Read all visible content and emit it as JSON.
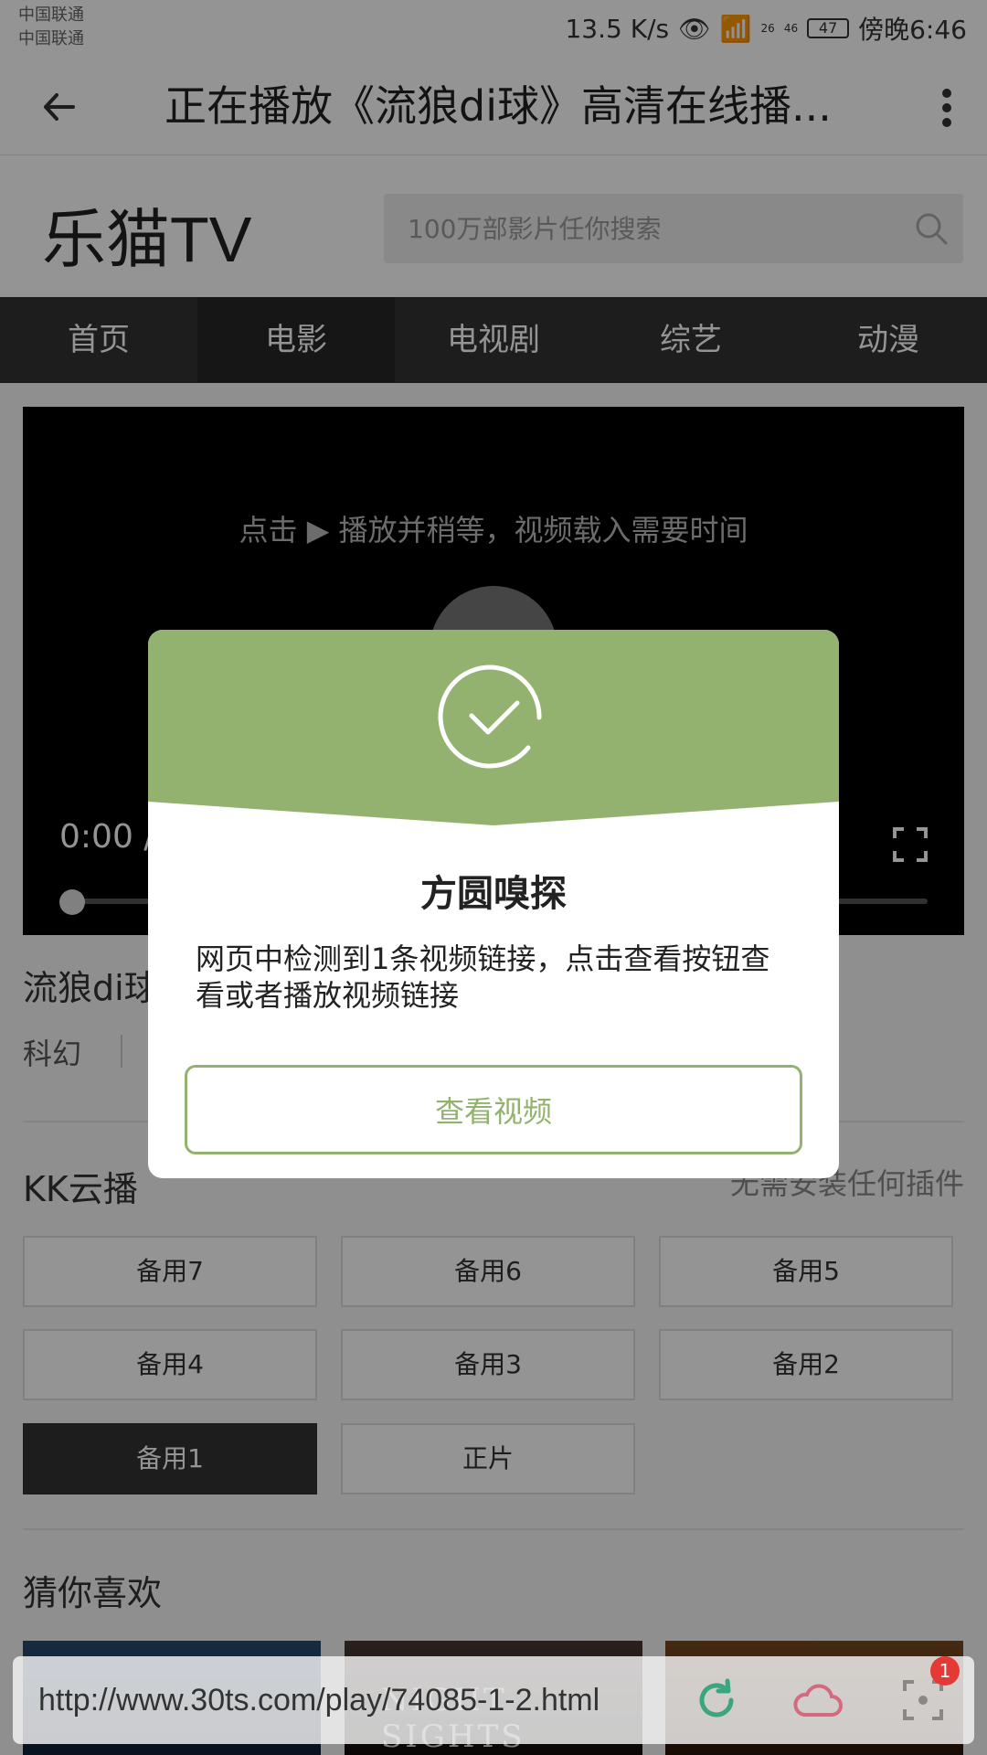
{
  "status_bar": {
    "carrier_1": "中国联通",
    "carrier_2": "中国联通",
    "speed": "13.5 K/s",
    "signal_1": "26",
    "signal_2": "46",
    "battery": "47",
    "time": "傍晚6:46"
  },
  "app_bar": {
    "title": "正在播放《流狼di球》高清在线播..."
  },
  "site": {
    "logo": "乐猫TV",
    "search_placeholder": "100万部影片任你搜索"
  },
  "nav": {
    "tabs": [
      "首页",
      "电影",
      "电视剧",
      "综艺",
      "动漫"
    ],
    "active_index": 1
  },
  "video": {
    "hint": "点击 ▶ 播放并稍等，视频载入需要时间",
    "time": "0:00 /"
  },
  "movie": {
    "title": "流狼di球",
    "genre": "科幻"
  },
  "sources": {
    "title": "KK云播",
    "note": "无需安装任何插件",
    "buttons": [
      "备用7",
      "备用6",
      "备用5",
      "备用4",
      "备用3",
      "备用2",
      "备用1",
      "正片"
    ],
    "active": "备用1"
  },
  "recommend": {
    "title": "猜你喜欢",
    "thumb_2_text": "NIGHT SIGHTS"
  },
  "url_bar": {
    "url": "http://www.30ts.com/play/74085-1-2.html",
    "badge": "1"
  },
  "dialog": {
    "title": "方圆嗅探",
    "message": "网页中检测到1条视频链接，点击查看按钮查看或者播放视频链接",
    "button": "查看视频",
    "accent_color": "#93b26f"
  },
  "icons": [
    "back-icon",
    "more-vert-icon",
    "search-icon",
    "play-icon",
    "fullscreen-icon",
    "check-circle-icon",
    "refresh-icon",
    "cloud-icon",
    "scan-icon"
  ]
}
